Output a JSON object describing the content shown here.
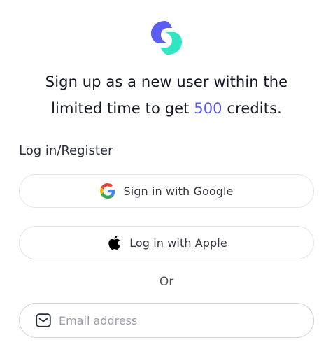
{
  "brand": {
    "logo_icon": "brand-logo-icon",
    "colors": {
      "primary": "#5b5cf0",
      "secondary": "#2ee6c2"
    }
  },
  "headline": {
    "line1": "Sign up as a new user within the",
    "line2_prefix": "limited time to get ",
    "highlight": "500",
    "line2_suffix": " credits."
  },
  "auth": {
    "section_label": "Log in/Register",
    "google_button": {
      "label": "Sign in with Google",
      "icon": "google-icon"
    },
    "apple_button": {
      "label": "Log in with Apple",
      "icon": "apple-icon"
    },
    "divider_text": "Or",
    "email": {
      "placeholder": "Email address",
      "value": "",
      "icon": "mail-icon"
    }
  }
}
